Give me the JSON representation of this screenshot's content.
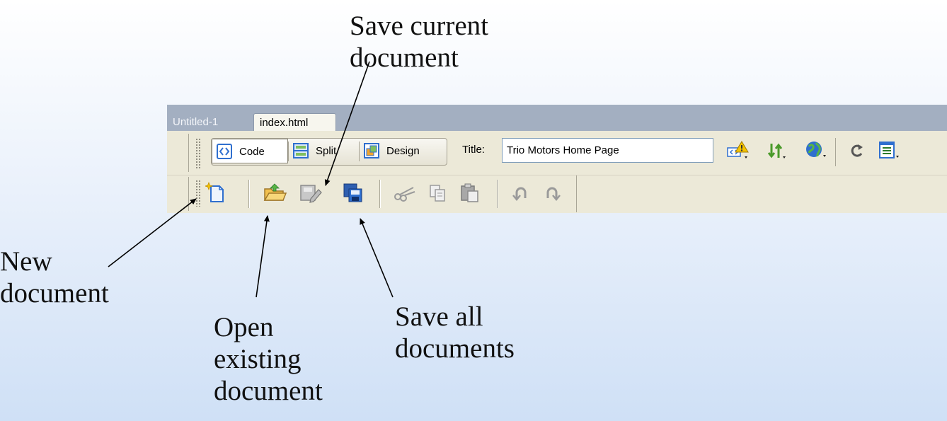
{
  "callouts": {
    "save_current": "Save current\ndocument",
    "new_document": "New\ndocument",
    "open_existing": "Open\nexisting\ndocument",
    "save_all": "Save all\ndocuments"
  },
  "tabs": [
    {
      "label": "Untitled-1",
      "active": false
    },
    {
      "label": "index.html",
      "active": true
    }
  ],
  "document_toolbar": {
    "code_label": "Code",
    "split_label": "Split",
    "design_label": "Design",
    "title_label": "Title:",
    "title_value": "Trio Motors Home Page",
    "right_icons": [
      "validate-markup-icon",
      "file-management-icon",
      "preview-browser-icon",
      "refresh-icon",
      "view-options-icon"
    ]
  },
  "standard_toolbar": {
    "icons": [
      "new-document-icon",
      "open-icon",
      "save-icon",
      "save-all-icon",
      "cut-icon",
      "copy-icon",
      "paste-icon",
      "undo-icon",
      "redo-icon"
    ]
  },
  "colors": {
    "tabbar": "#a3afc1",
    "toolbar": "#ece9d8",
    "accent_blue": "#2f6fcf",
    "warning_yellow": "#f5c400"
  }
}
